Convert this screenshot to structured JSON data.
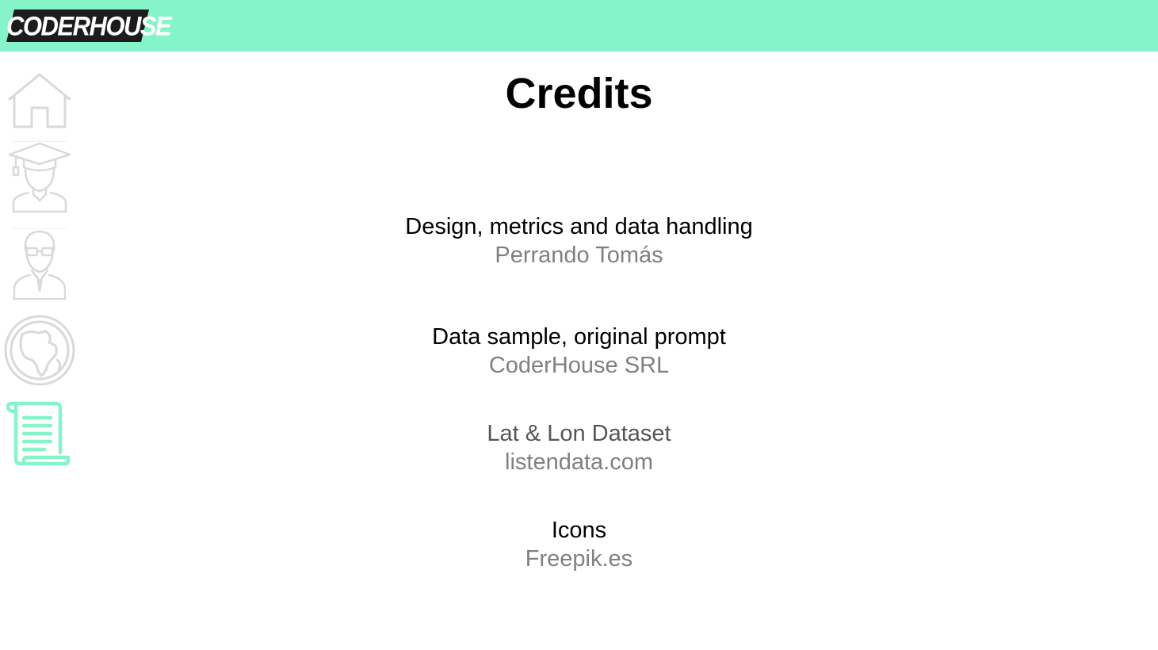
{
  "header": {
    "logo_text": "CODERHOUSE",
    "bg_color": "#86F4CA"
  },
  "sidebar": {
    "items": [
      {
        "id": "home",
        "icon": "home-icon",
        "active": false
      },
      {
        "id": "graduate",
        "icon": "graduate-student-icon",
        "active": false
      },
      {
        "id": "teacher",
        "icon": "teacher-icon",
        "active": false
      },
      {
        "id": "world",
        "icon": "globe-icon",
        "active": false
      },
      {
        "id": "credits",
        "icon": "scroll-icon",
        "active": true
      }
    ],
    "inactive_color": "#d9d9d9",
    "active_color": "#86F4CA"
  },
  "main": {
    "title": "Credits",
    "credits": [
      {
        "role": "Design, metrics and data handling",
        "who": "Perrando Tomás"
      },
      {
        "role": "Data sample, original prompt",
        "who": "CoderHouse SRL"
      },
      {
        "role": "Lat & Lon Dataset",
        "who": "listendata.com"
      },
      {
        "role": "Icons",
        "who": "Freepik.es"
      }
    ]
  }
}
